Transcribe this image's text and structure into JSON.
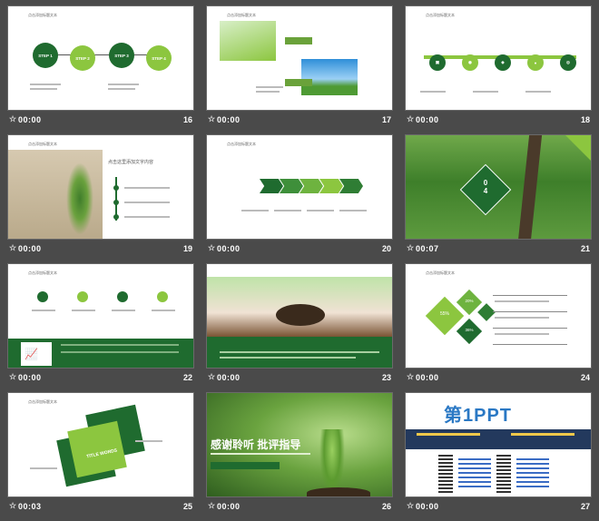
{
  "slides": [
    {
      "number": "16",
      "time": "00:00",
      "header": "点击添加标题文本",
      "steps": [
        "STEP 1",
        "STEP 2",
        "STEP 3",
        "STEP 4"
      ]
    },
    {
      "number": "17",
      "time": "00:00",
      "header": "点击添加标题文本"
    },
    {
      "number": "18",
      "time": "00:00",
      "header": "点击添加标题文本"
    },
    {
      "number": "19",
      "time": "00:00",
      "header": "点击添加标题文本",
      "title": "点击这里添加文字内容"
    },
    {
      "number": "20",
      "time": "00:00",
      "header": "点击添加标题文本"
    },
    {
      "number": "21",
      "time": "00:07",
      "badge": "0\n4"
    },
    {
      "number": "22",
      "time": "00:00",
      "header": "点击添加标题文本"
    },
    {
      "number": "23",
      "time": "00:00"
    },
    {
      "number": "24",
      "time": "00:00",
      "header": "点击添加标题文本",
      "percents": [
        "20%",
        "55%",
        "36%"
      ]
    },
    {
      "number": "25",
      "time": "00:03",
      "header": "点击添加标题文本",
      "badge": "TITLE WORDS"
    },
    {
      "number": "26",
      "time": "00:00",
      "title": "感谢聆听  批评指导"
    },
    {
      "number": "27",
      "time": "00:00",
      "brand": "第1PPT"
    }
  ],
  "colors": {
    "dark_green": "#1f6b2f",
    "light_green": "#8cc63f",
    "bg": "#4a4a4a"
  }
}
